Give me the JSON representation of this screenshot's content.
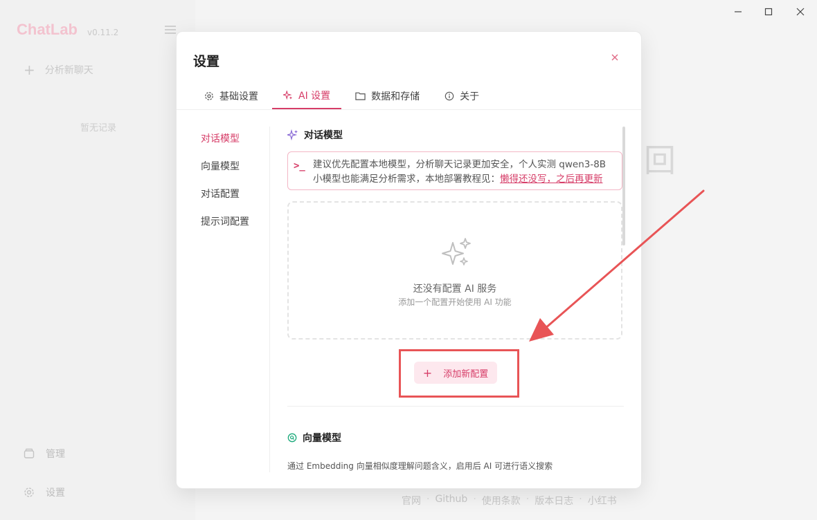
{
  "app": {
    "brand": "ChatLab",
    "version": "v0.11.2",
    "new_chat_label": "分析新聊天",
    "empty_records": "暂无记录",
    "manage_label": "管理",
    "settings_label": "设置",
    "footer_links": [
      "官网",
      "Github",
      "使用条款",
      "版本日志",
      "小红书"
    ],
    "footer_sep": "·"
  },
  "dialog": {
    "title": "设置",
    "tabs": [
      {
        "label": "基础设置",
        "icon": "gear-icon"
      },
      {
        "label": "AI 设置",
        "icon": "sparkle-icon",
        "active": true
      },
      {
        "label": "数据和存储",
        "icon": "folder-icon"
      },
      {
        "label": "关于",
        "icon": "info-icon"
      }
    ],
    "subnav": [
      "对话模型",
      "向量模型",
      "对话配置",
      "提示词配置"
    ],
    "chat_model": {
      "title": "对话模型",
      "alert_line1": "建议优先配置本地模型，分析聊天记录更加安全，个人实测 qwen3-8B",
      "alert_line2": "小模型也能满足分析需求，本地部署教程见：",
      "alert_link": "懒得还没写，之后再更新",
      "empty_title": "还没有配置 AI 服务",
      "empty_sub": "添加一个配置开始使用 AI 功能",
      "add_button": "添加新配置"
    },
    "vector_model": {
      "title": "向量模型",
      "desc": "通过 Embedding 向量相似度理解问题含义，启用后 AI 可进行语义搜索"
    }
  },
  "colors": {
    "accent": "#d63c67",
    "annotation_red": "#e85456"
  }
}
